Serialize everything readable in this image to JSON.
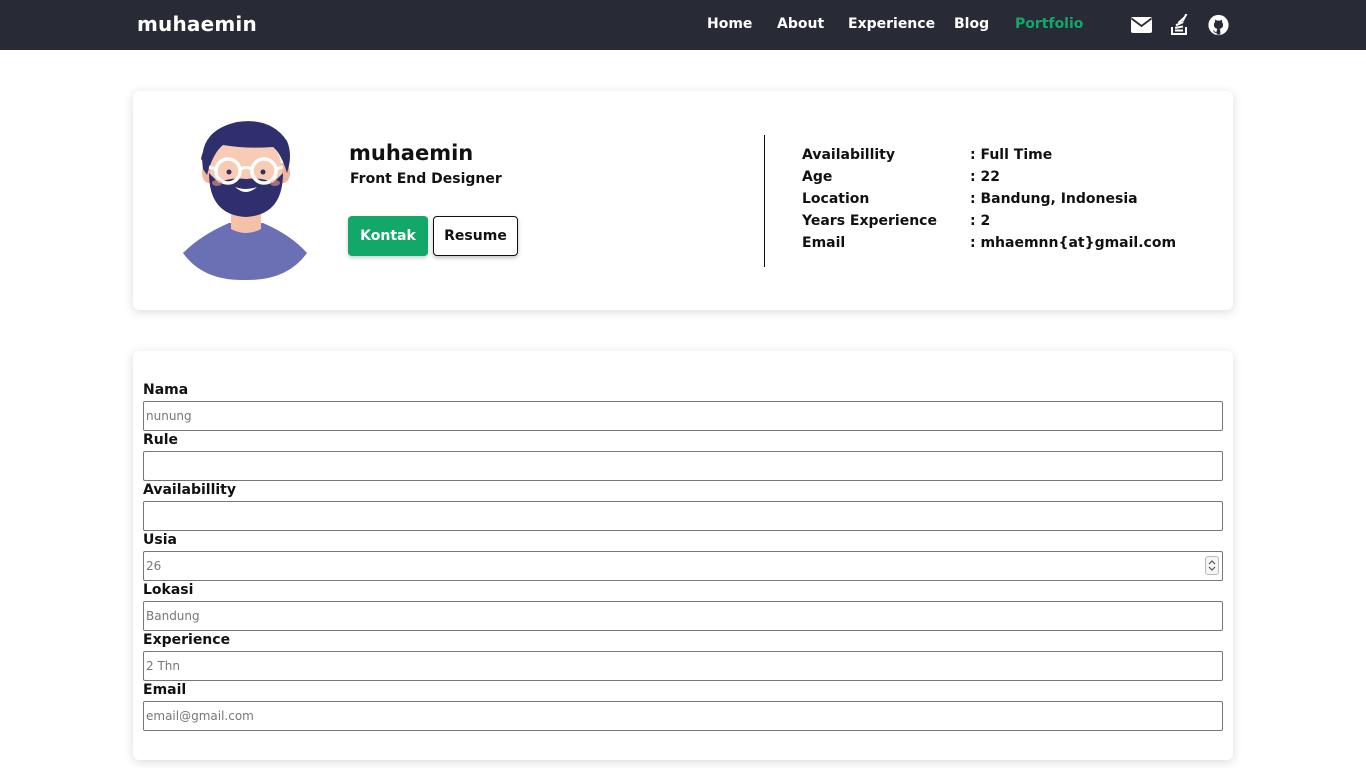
{
  "nav": {
    "brand": "muhaemin",
    "links": [
      {
        "label": "Home"
      },
      {
        "label": "About"
      },
      {
        "label": "Experience"
      },
      {
        "label": "Blog"
      },
      {
        "label": "Portfolio"
      }
    ],
    "active_link": "Portfolio",
    "icons": [
      "envelope-icon",
      "stackoverflow-icon",
      "github-icon"
    ]
  },
  "profile": {
    "name": "muhaemin",
    "role": "Front End Designer",
    "contact_button": "Kontak",
    "resume_button": "Resume",
    "details": [
      {
        "label": "Availabillity",
        "value": ": Full Time"
      },
      {
        "label": "Age",
        "value": ": 22"
      },
      {
        "label": "Location",
        "value": ": Bandung, Indonesia"
      },
      {
        "label": "Years Experience",
        "value": ": 2"
      },
      {
        "label": "Email",
        "value": ": mhaemnn{at}gmail.com"
      }
    ]
  },
  "form": {
    "fields": [
      {
        "label": "Nama",
        "placeholder": "nunung",
        "value": ""
      },
      {
        "label": "Rule",
        "placeholder": "",
        "value": ""
      },
      {
        "label": "Availabillity",
        "placeholder": "",
        "value": ""
      },
      {
        "label": "Usia",
        "placeholder": "26",
        "value": ""
      },
      {
        "label": "Lokasi",
        "placeholder": "Bandung",
        "value": ""
      },
      {
        "label": "Experience",
        "placeholder": "2 Thn",
        "value": ""
      },
      {
        "label": "Email",
        "placeholder": "email@gmail.com",
        "value": ""
      }
    ]
  },
  "colors": {
    "navbar_bg": "#282b35",
    "accent": "#12a86a",
    "text": "#111111"
  }
}
